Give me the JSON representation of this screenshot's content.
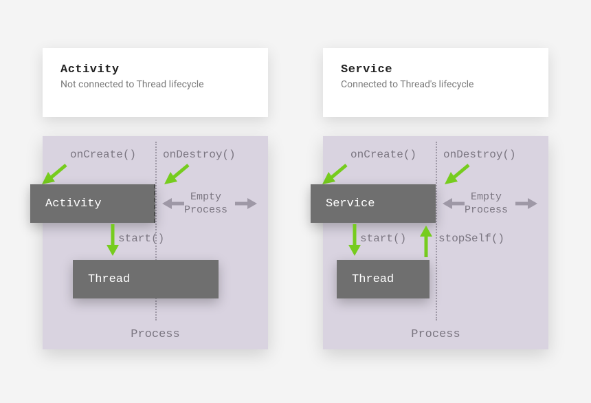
{
  "left": {
    "panel": {
      "title": "Activity",
      "subtitle": "Not connected to Thread lifecycle"
    },
    "labels": {
      "onCreate": "onCreate()",
      "onDestroy": "onDestroy()",
      "start": "start()",
      "empty": "Empty\nProcess",
      "process": "Process"
    },
    "boxes": {
      "main": "Activity",
      "thread": "Thread"
    }
  },
  "right": {
    "panel": {
      "title": "Service",
      "subtitle": "Connected to Thread's lifecycle"
    },
    "labels": {
      "onCreate": "onCreate()",
      "onDestroy": "onDestroy()",
      "start": "start()",
      "stopSelf": "stopSelf()",
      "empty": "Empty\nProcess",
      "process": "Process"
    },
    "boxes": {
      "main": "Service",
      "thread": "Thread"
    }
  }
}
